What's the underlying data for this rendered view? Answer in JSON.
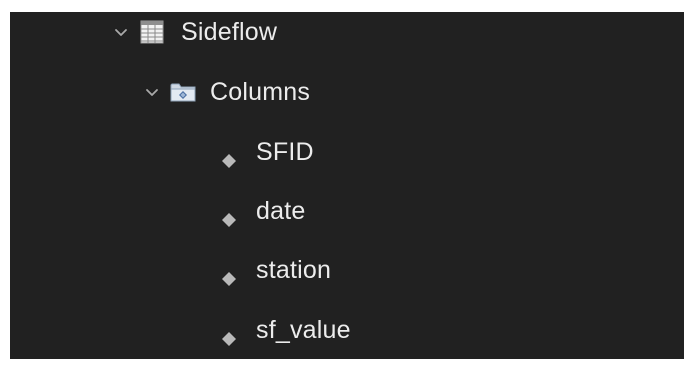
{
  "tree": {
    "table": {
      "label": "Sideflow",
      "expanded": true,
      "icon": "table-icon",
      "folder": {
        "label": "Columns",
        "expanded": true,
        "icon": "folder-icon",
        "columns": [
          {
            "label": "SFID",
            "icon": "column-diamond-icon"
          },
          {
            "label": "date",
            "icon": "column-diamond-icon"
          },
          {
            "label": "station",
            "icon": "column-diamond-icon"
          },
          {
            "label": "sf_value",
            "icon": "column-diamond-icon"
          }
        ]
      }
    }
  },
  "colors": {
    "panel_background": "#212121",
    "text": "#ececec",
    "chevron": "#a9a9a9"
  }
}
